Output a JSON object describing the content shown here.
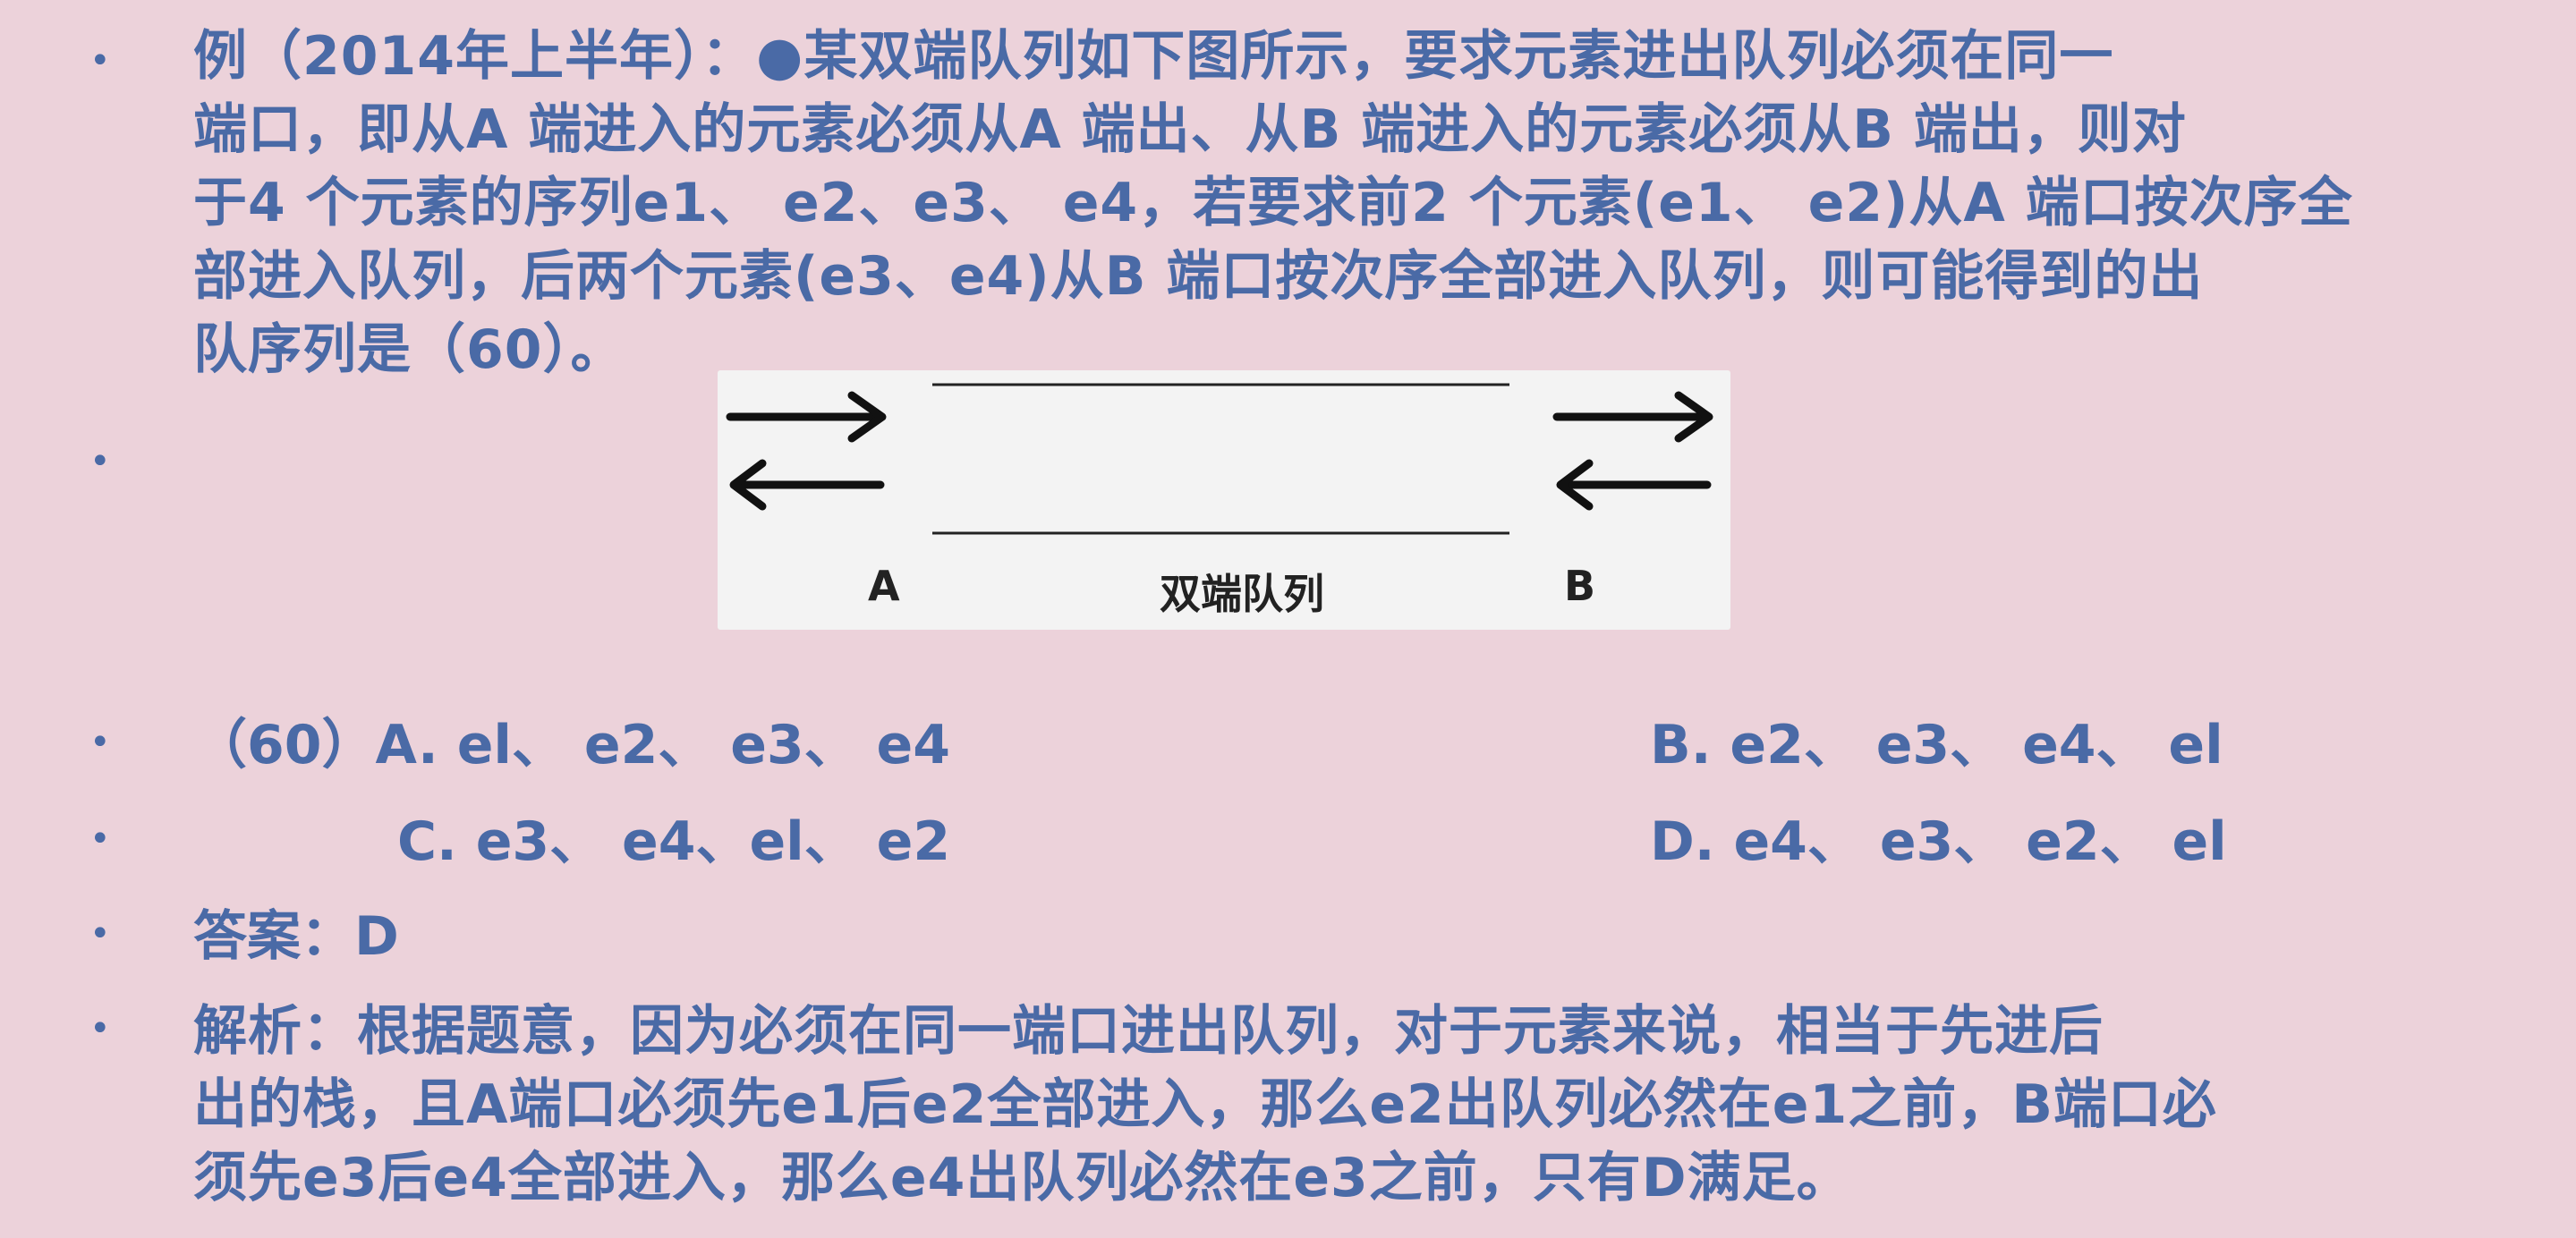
{
  "question": {
    "lines": [
      "例（2014年上半年）：●某双端队列如下图所示，要求元素进出队列必须在同一",
      "端口，即从A 端进入的元素必须从A 端出、从B 端进入的元素必须从B 端出，则对",
      "于4 个元素的序列e1、 e2、e3、 e4，若要求前2 个元素(e1、 e2)从A 端口按次序全",
      "部进入队列，后两个元素(e3、e4)从B 端口按次序全部进入队列，则可能得到的出",
      "队序列是（60）。"
    ]
  },
  "diagram": {
    "label_a": "A",
    "label_b": "B",
    "caption": "双端队列"
  },
  "options": {
    "a": "（60）A. el、 e2、 e3、 e4",
    "b": "B. e2、 e3、 e4、 el",
    "c": "C. e3、 e4、el、 e2",
    "d": "D. e4、 e3、 e2、 el"
  },
  "answer": "答案：D",
  "analysis": {
    "lines": [
      "解析：根据题意，因为必须在同一端口进出队列，对于元素来说，相当于先进后",
      "出的栈，且A端口必须先e1后e2全部进入，那么e2出队列必然在e1之前，B端口必",
      "须先e3后e4全部进入，那么e4出队列必然在e3之前，只有D满足。"
    ]
  },
  "colors": {
    "background": "#ecd2da",
    "text": "#4a6aa6",
    "diagram_bg": "#f3f3f3"
  }
}
